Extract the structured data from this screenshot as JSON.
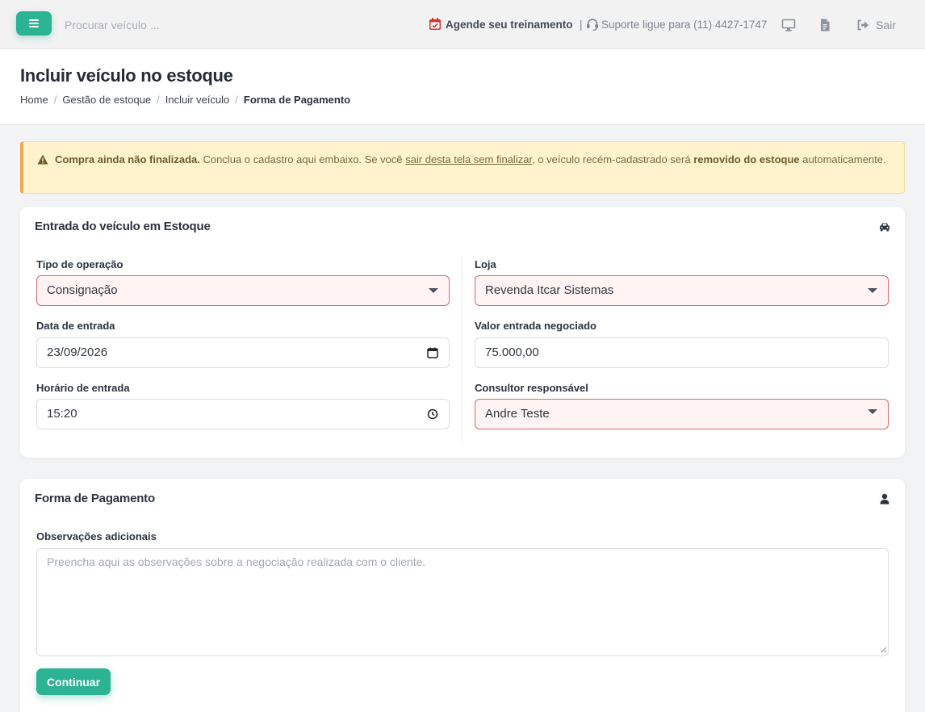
{
  "colors": {
    "accent": "#2bb394",
    "alert_bg": "#fff3cd",
    "alert_border": "#f0a64f",
    "invalid_border": "#d96a6a",
    "invalid_bg": "#fff3f3"
  },
  "topbar": {
    "menu_icon": "hamburger-icon",
    "search_placeholder": "Procurar veículo ...",
    "training_label": "Agende seu treinamento",
    "separator": "|",
    "support_label": "Suporte ligue para (11) 4427-1747",
    "icons": [
      "calendar-icon",
      "headset-icon",
      "monitor-icon",
      "document-icon",
      "logout-icon"
    ],
    "logout_label": "Sair"
  },
  "page": {
    "title": "Incluir veículo no estoque",
    "breadcrumb": [
      {
        "label": "Home"
      },
      {
        "label": "Gestão de estoque"
      },
      {
        "label": "Incluir veículo"
      },
      {
        "label": "Forma de Pagamento"
      }
    ],
    "breadcrumb_separator": "/"
  },
  "alert": {
    "bold_start": "Compra ainda não finalizada.",
    "text1": " Conclua o cadastro aqui embaixo. Se você ",
    "link": "sair desta tela sem finalizar",
    "text2": ", o veículo recém-cadastrado será ",
    "bold_end": "removido do estoque",
    "text3": " automaticamente."
  },
  "entry_card": {
    "title": "Entrada do veículo em Estoque",
    "icon": "car-icon",
    "fields": {
      "tipo_operacao": {
        "label": "Tipo de operação",
        "value": "Consignação"
      },
      "data_entrada": {
        "label": "Data de entrada",
        "value": "23/09/2026"
      },
      "horario_entrada": {
        "label": "Horário de entrada",
        "value": "15:20"
      },
      "loja": {
        "label": "Loja",
        "value": "Revenda Itcar Sistemas"
      },
      "valor_entrada": {
        "label": "Valor entrada negociado",
        "value": "75.000,00"
      },
      "consultor": {
        "label": "Consultor responsável",
        "value": "Andre Teste"
      }
    }
  },
  "payment_card": {
    "title": "Forma de Pagamento",
    "icon": "user-icon",
    "observacoes_label": "Observações adicionais",
    "observacoes_placeholder": "Preencha aqui as observações sobre a negociação realizada com o cliente.",
    "observacoes_value": "",
    "continue_label": "Continuar"
  }
}
